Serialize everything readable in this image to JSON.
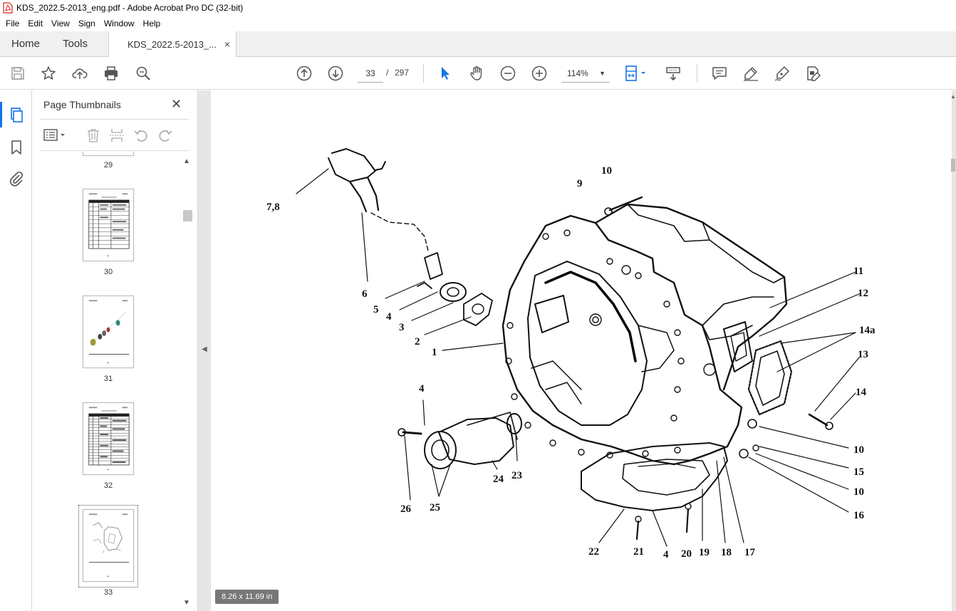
{
  "window": {
    "title": "KDS_2022.5-2013_eng.pdf - Adobe Acrobat Pro DC (32-bit)"
  },
  "menu": [
    "File",
    "Edit",
    "View",
    "Sign",
    "Window",
    "Help"
  ],
  "tabs": {
    "home": "Home",
    "tools": "Tools",
    "document": "KDS_2022.5-2013_...",
    "close_glyph": "×"
  },
  "toolbar": {
    "current_page": "33",
    "page_separator": "/",
    "total_pages": "297",
    "zoom": "114%",
    "zoom_caret": "▼"
  },
  "thumbnails_panel": {
    "title": "Page Thumbnails",
    "close_glyph": "✕",
    "pages": [
      {
        "number": "29"
      },
      {
        "number": "30"
      },
      {
        "number": "31"
      },
      {
        "number": "32"
      },
      {
        "number": "33",
        "selected": true
      }
    ]
  },
  "document": {
    "page_size": "8.26 x 11.69 in",
    "callouts": [
      "7,8",
      "10",
      "9",
      "6",
      "5",
      "4",
      "3",
      "2",
      "1",
      "11",
      "12",
      "14a",
      "13",
      "14",
      "4",
      "26",
      "25",
      "24",
      "23",
      "10",
      "15",
      "10",
      "16",
      "22",
      "21",
      "4",
      "20",
      "19",
      "18",
      "17"
    ]
  },
  "colors": {
    "accent": "#1473e6",
    "pdf_red": "#d8261e"
  }
}
